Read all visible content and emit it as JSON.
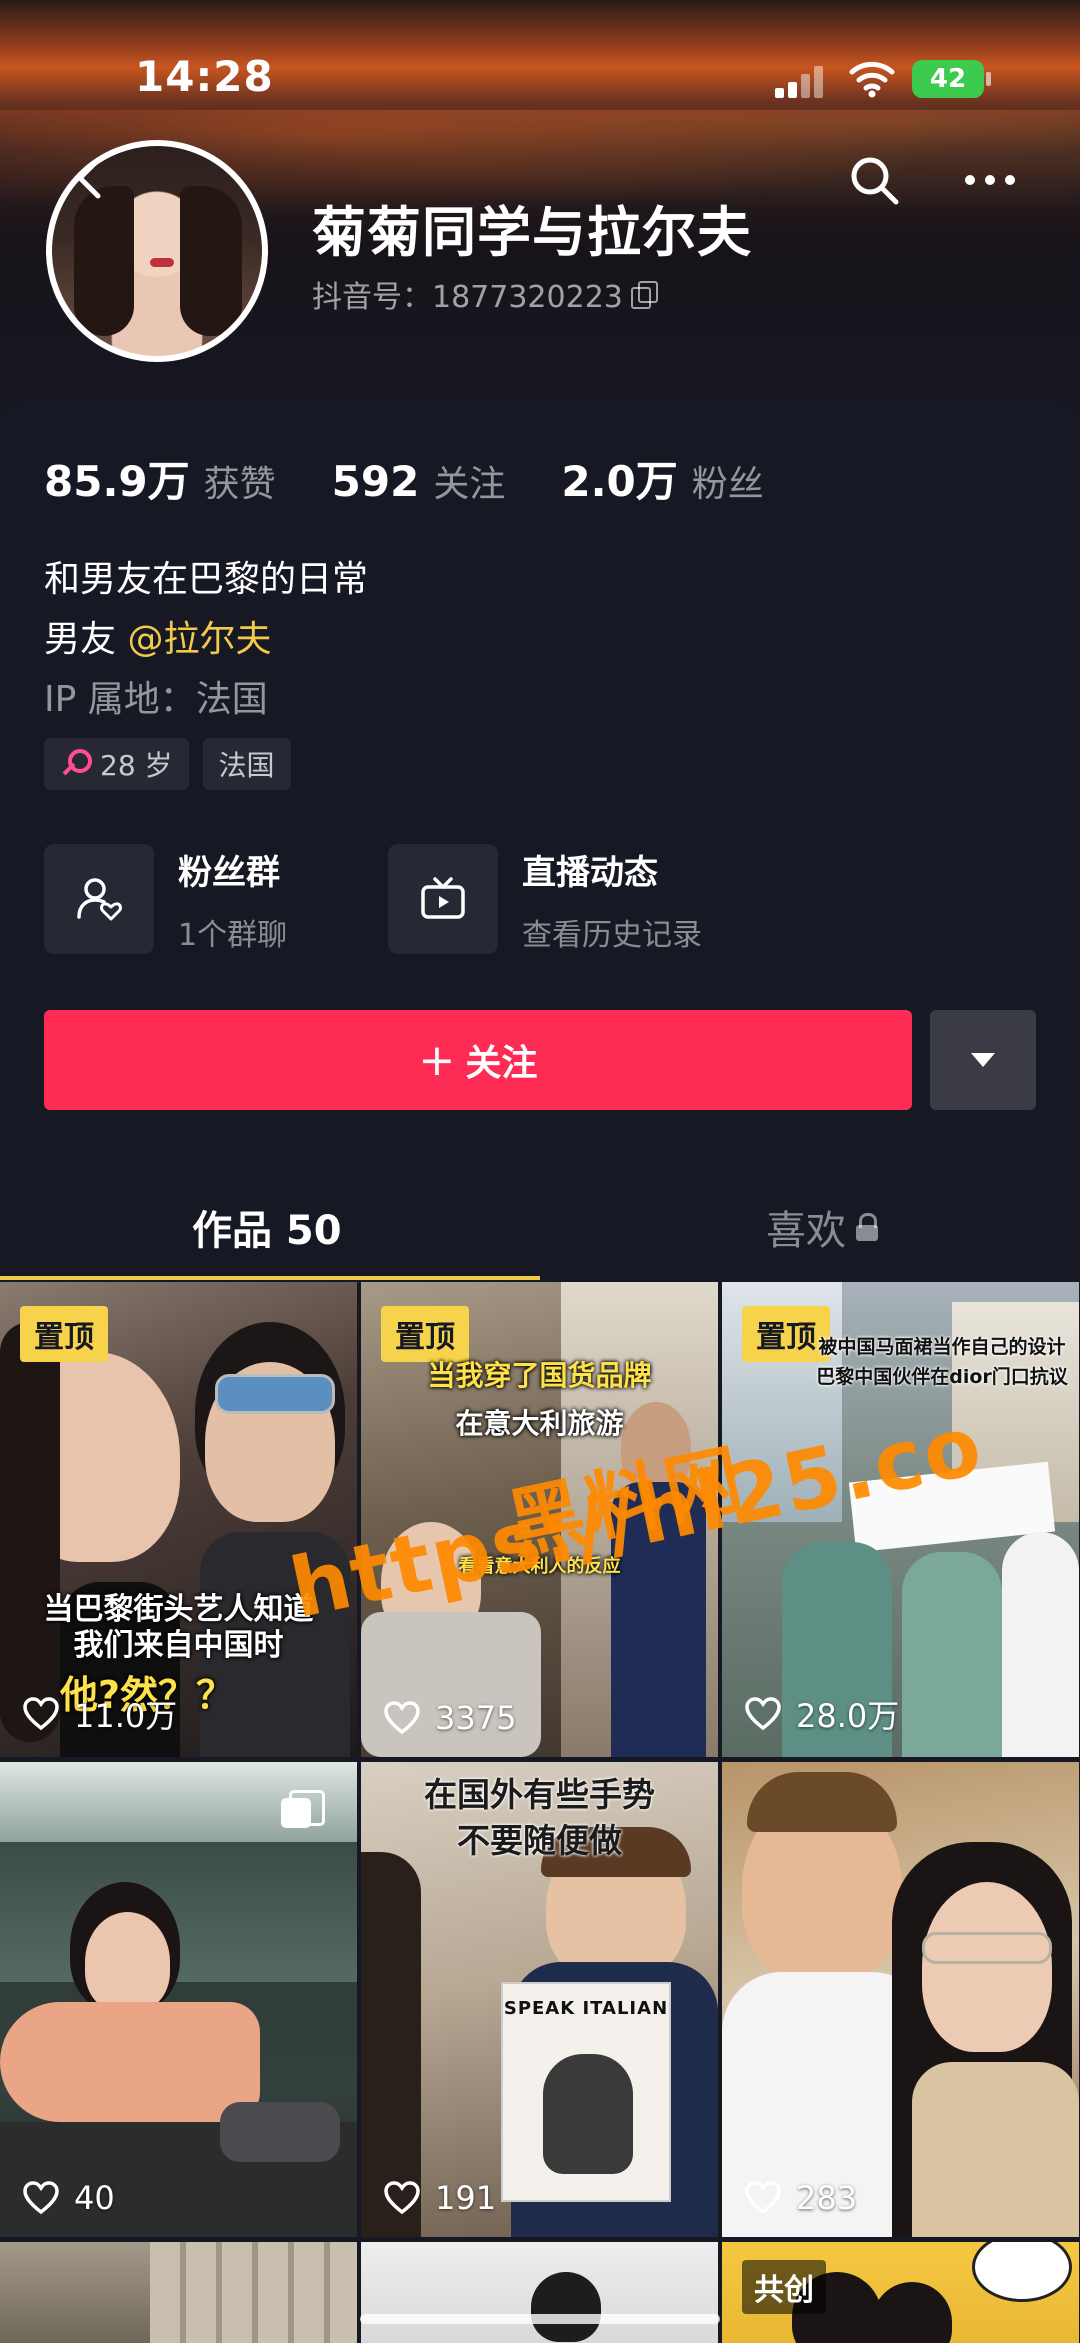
{
  "status_bar": {
    "time": "14:28",
    "battery": "42"
  },
  "profile": {
    "name": "菊菊同学与拉尔夫",
    "douyin_id": "抖音号：1877320223"
  },
  "stats": [
    {
      "value": "85.9万",
      "label": "获赞"
    },
    {
      "value": "592",
      "label": "关注"
    },
    {
      "value": "2.0万",
      "label": "粉丝"
    }
  ],
  "bio": {
    "line1": "和男友在巴黎的日常",
    "line2_prefix": "男友 ",
    "mention": "@拉尔夫",
    "ip": "IP 属地：法国"
  },
  "tags": {
    "age": "28 岁",
    "location": "法国"
  },
  "cards": [
    {
      "title": "粉丝群",
      "sub": "1个群聊",
      "icon": "fan-group-icon"
    },
    {
      "title": "直播动态",
      "sub": "查看历史记录",
      "icon": "live-tv-icon"
    }
  ],
  "follow_button": {
    "label": "关注",
    "plus": "+"
  },
  "tabs": {
    "works": "作品 50",
    "likes": "喜欢"
  },
  "grid": [
    {
      "badge": "置顶",
      "likes": "11.0万",
      "caption": [
        "当巴黎街头艺人知道",
        "我们来自中国时"
      ],
      "caption2": "他?然？？"
    },
    {
      "badge": "置顶",
      "likes": "3375",
      "caption": [
        "当我穿了国货品牌",
        "在意大利旅游"
      ],
      "caption2": "看看意大利人的反应"
    },
    {
      "badge": "置顶",
      "likes": "28.0万",
      "caption": [
        "被中国马面裙当作自己的设计",
        "巴黎中国伙伴在dior门口抗议"
      ],
      "caption2": ""
    },
    {
      "badge": "",
      "likes": "40",
      "caption": [],
      "caption2": ""
    },
    {
      "badge": "",
      "likes": "191",
      "caption": [
        "在国外有些手势",
        "不要随便做"
      ],
      "caption2": "SPEAK ITALIAN"
    },
    {
      "badge": "",
      "likes": "283",
      "caption": [],
      "caption2": ""
    },
    {
      "badge": "",
      "likes": "",
      "caption": [],
      "caption2": ""
    },
    {
      "badge": "",
      "likes": "",
      "caption": [],
      "caption2": ""
    },
    {
      "badge": "共创",
      "likes": "",
      "caption": [],
      "caption2": ""
    }
  ],
  "watermark": {
    "line1": "黑料网",
    "line2": "https://hl25.co"
  },
  "colors": {
    "background": "#161823",
    "follow": "#fe2c55",
    "accent_yellow": "#f2c94c",
    "badge_yellow": "#f6d34b"
  }
}
